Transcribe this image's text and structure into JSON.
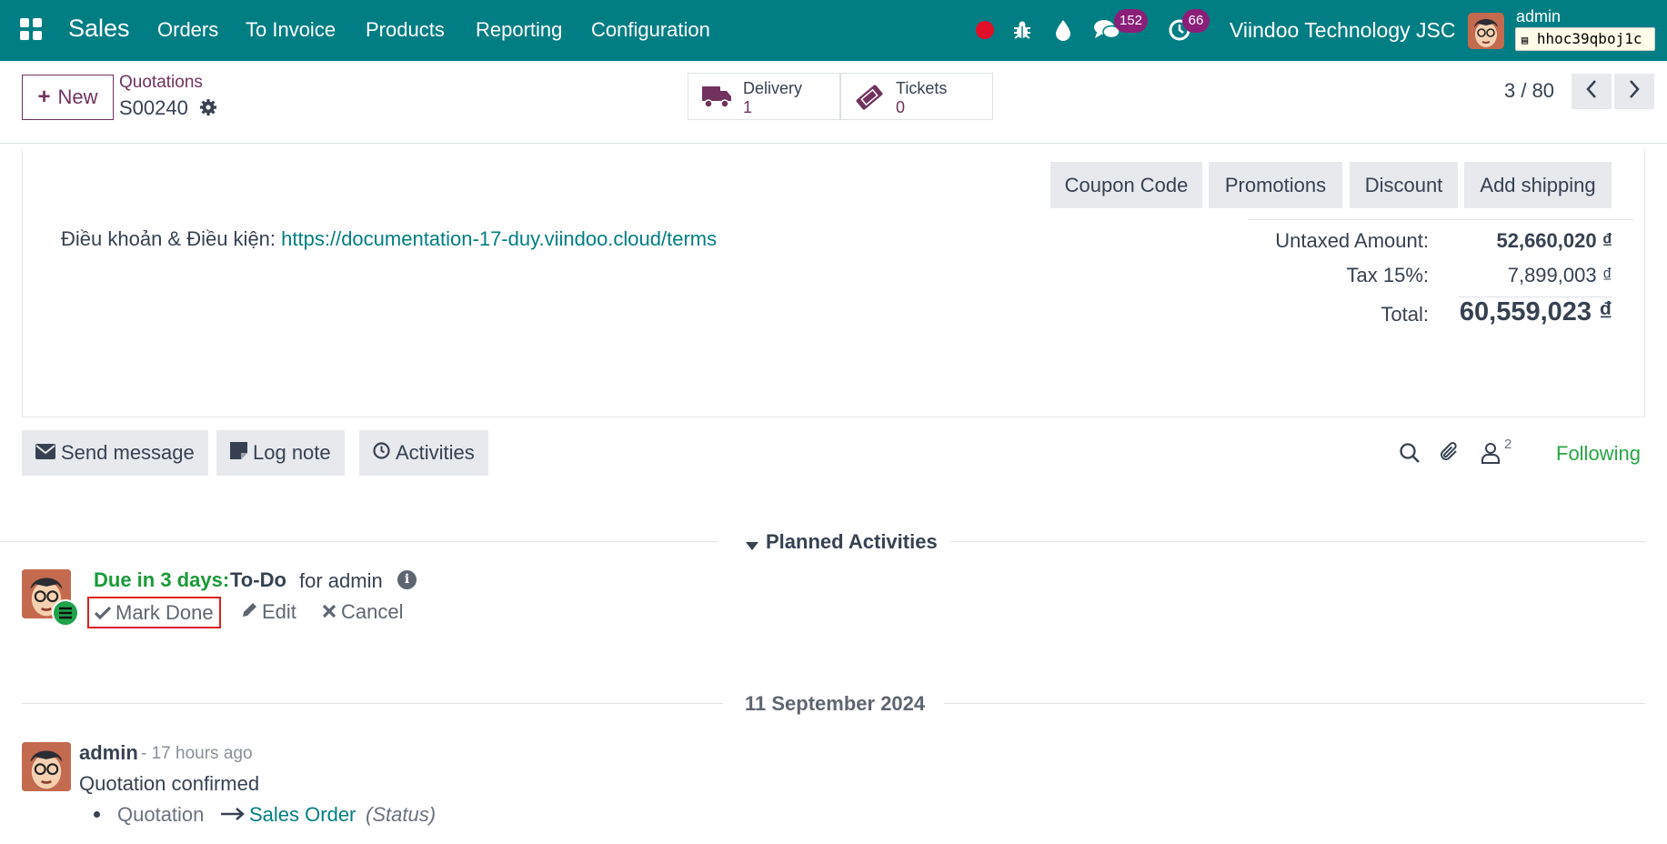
{
  "navbar": {
    "app_name": "Sales",
    "menu": [
      "Orders",
      "To Invoice",
      "Products",
      "Reporting",
      "Configuration"
    ],
    "messages_count": "152",
    "activities_count": "66",
    "company": "Viindoo Technology JSC",
    "user": "admin",
    "database": "hhoc39qboj1c"
  },
  "control": {
    "new_label": "New",
    "breadcrumb": "Quotations",
    "record": "S00240",
    "smart_buttons": [
      {
        "label": "Delivery",
        "value": "1"
      },
      {
        "label": "Tickets",
        "value": "0"
      }
    ],
    "pager": "3 / 80"
  },
  "sheet": {
    "buttons": [
      "Coupon Code",
      "Promotions",
      "Discount",
      "Add shipping"
    ],
    "terms_label": "Điều khoản & Điều kiện:",
    "terms_link": "https://documentation-17-duy.viindoo.cloud/terms",
    "totals": {
      "untaxed_label": "Untaxed Amount:",
      "untaxed_value": "52,660,020 ₫",
      "tax_label": "Tax 15%:",
      "tax_value": "7,899,003 ₫",
      "total_label": "Total:",
      "total_value": "60,559,023 ₫"
    }
  },
  "chatter": {
    "send_message": "Send message",
    "log_note": "Log note",
    "activities": "Activities",
    "followers_count": "2",
    "following": "Following",
    "planned_title": "Planned Activities",
    "activity": {
      "due": "Due in 3 days:",
      "type": "To-Do",
      "assignee": "for admin",
      "mark_done": "Mark Done",
      "edit": "Edit",
      "cancel": "Cancel"
    },
    "date_separator": "11 September 2024",
    "message": {
      "author": "admin",
      "time": "- 17 hours ago",
      "body": "Quotation confirmed",
      "old_value": "Quotation",
      "new_value": "Sales Order",
      "field": "(Status)"
    }
  },
  "colors": {
    "navbar": "#017e84",
    "brand_purple": "#71325f",
    "link_teal": "#017e84",
    "following_green": "#28a745",
    "due_green": "#1a9a38",
    "highlight_red": "#e02020"
  }
}
